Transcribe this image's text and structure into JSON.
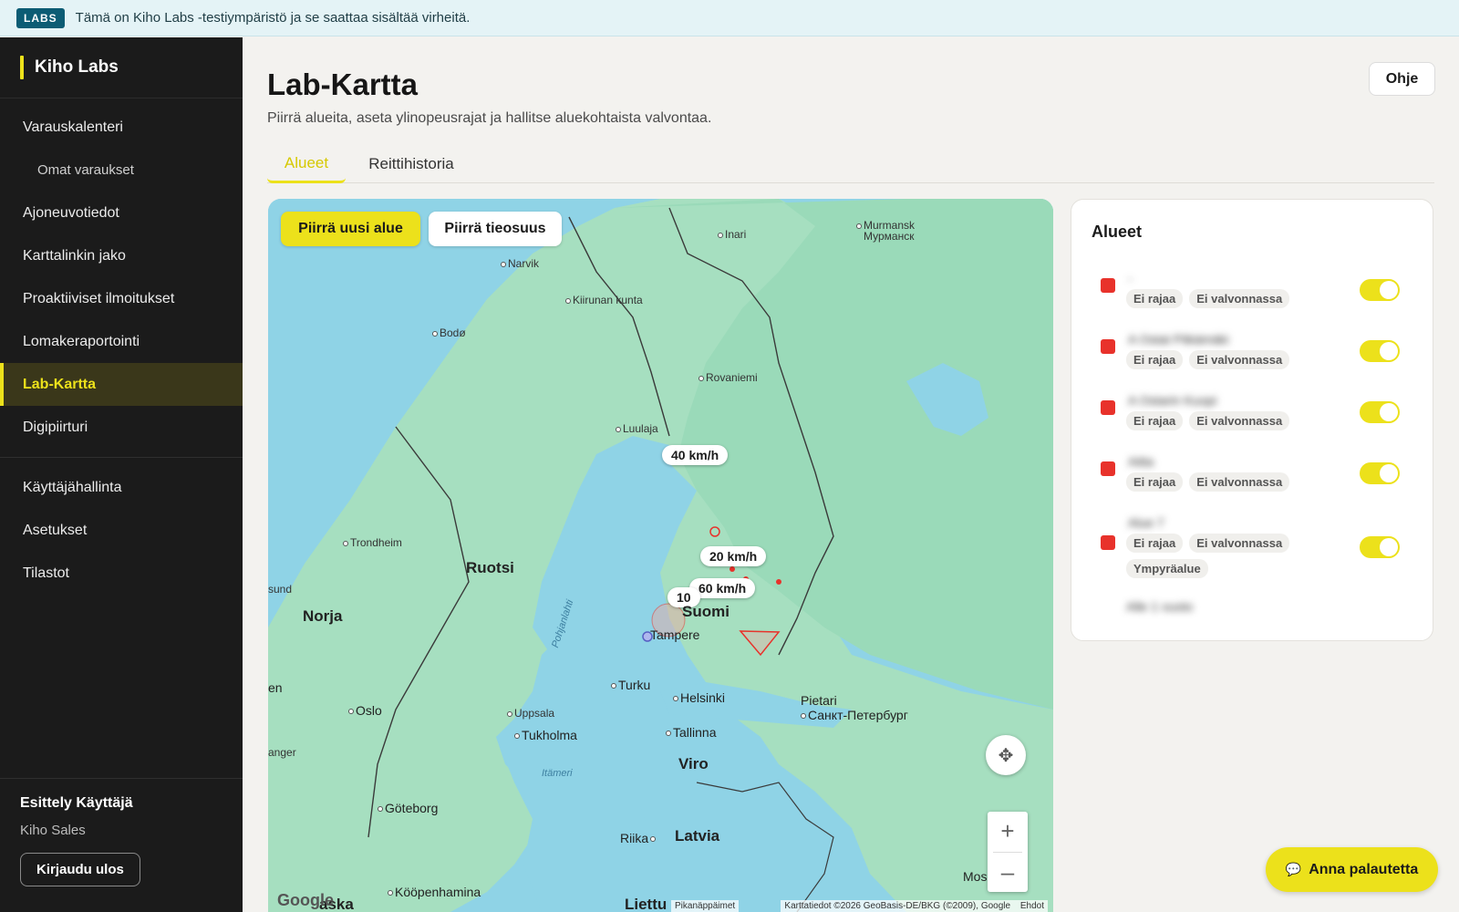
{
  "banner": {
    "badge": "LABS",
    "text": "Tämä on Kiho Labs -testiympäristö ja se saattaa sisältää virheitä."
  },
  "sidebar": {
    "brand": "Kiho Labs",
    "items": [
      {
        "label": "Varauskalenteri"
      },
      {
        "label": "Omat varaukset"
      },
      {
        "label": "Ajoneuvotiedot"
      },
      {
        "label": "Karttalinkin jako"
      },
      {
        "label": "Proaktiiviset ilmoitukset"
      },
      {
        "label": "Lomakeraportointi"
      },
      {
        "label": "Lab-Kartta"
      },
      {
        "label": "Digipiirturi"
      },
      {
        "label": "Käyttäjähallinta"
      },
      {
        "label": "Asetukset"
      },
      {
        "label": "Tilastot"
      }
    ],
    "active": "Lab-Kartta",
    "user": {
      "name": "Esittely Käyttäjä",
      "org": "Kiho Sales",
      "logout": "Kirjaudu ulos"
    }
  },
  "header": {
    "title": "Lab-Kartta",
    "subtitle": "Piirrä alueita, aseta ylinopeusrajat ja hallitse aluekohtaista valvontaa.",
    "help": "Ohje"
  },
  "tabs": [
    {
      "label": "Alueet"
    },
    {
      "label": "Reittihistoria"
    }
  ],
  "map": {
    "draw_area": "Piirrä uusi alue",
    "draw_road": "Piirrä tieosuus",
    "speed_labels": [
      "40 km/h",
      "20 km/h",
      "60 km/h",
      "10"
    ],
    "places": {
      "murmansk": "Murmansk",
      "murmansk_ru": "Мурманск",
      "inari": "Inari",
      "narvik": "Narvik",
      "kiruna": "Kiirunan kunta",
      "bodo": "Bodø",
      "rovaniemi": "Rovaniemi",
      "lulea": "Luulaja",
      "trondheim": "Trondheim",
      "ruotsi": "Ruotsi",
      "norja": "Norja",
      "suomi": "Suomi",
      "tampere": "Tampere",
      "turku": "Turku",
      "helsinki": "Helsinki",
      "pietari": "Pietari",
      "pietari_ru": "Санкт-Петербург",
      "oslo": "Oslo",
      "uppsala": "Uppsala",
      "tukholma": "Tukholma",
      "tallinna": "Tallinna",
      "viro": "Viro",
      "itameri": "Itämeri",
      "goteborg": "Göteborg",
      "riika": "Riika",
      "latvia": "Latvia",
      "moskova": "Moskova",
      "liettua": "Liettu",
      "kooppenhamina": "Kööpenhamina",
      "pohjanlahti": "Pohjanlahti",
      "aska": "aska",
      "sund": "sund",
      "en": "en",
      "anger": "anger"
    },
    "google": "Google",
    "shortcuts": "Pikanäppäimet",
    "attribution": "Karttatiedot ©2026 GeoBasis-DE/BKG (©2009), Google",
    "terms": "Ehdot"
  },
  "panel": {
    "title": "Alueet",
    "areas": [
      {
        "name": "-",
        "chips": [
          "Ei rajaa",
          "Ei valvonnassa"
        ],
        "color": "#e8322b",
        "enabled": true
      },
      {
        "name": "A Ostat Pitkämäki",
        "chips": [
          "Ei rajaa",
          "Ei valvonnassa"
        ],
        "color": "#e8322b",
        "enabled": true
      },
      {
        "name": "A Ostarin Kuopi",
        "chips": [
          "Ei rajaa",
          "Ei valvonnassa"
        ],
        "color": "#e8322b",
        "enabled": true
      },
      {
        "name": "Aitta",
        "chips": [
          "Ei rajaa",
          "Ei valvonnassa"
        ],
        "color": "#e8322b",
        "enabled": true
      },
      {
        "name": "Alue 7",
        "chips": [
          "Ei rajaa",
          "Ei valvonnassa",
          "Ympyräalue"
        ],
        "color": "#e8322b",
        "enabled": true
      }
    ],
    "extra": "Alle 1 vuoto"
  },
  "feedback": "Anna palautetta",
  "colors": {
    "accent": "#ece11b",
    "sidebar": "#1b1b1b",
    "area": "#e8322b",
    "water": "#8fd3e6",
    "land": "#9adab9"
  }
}
